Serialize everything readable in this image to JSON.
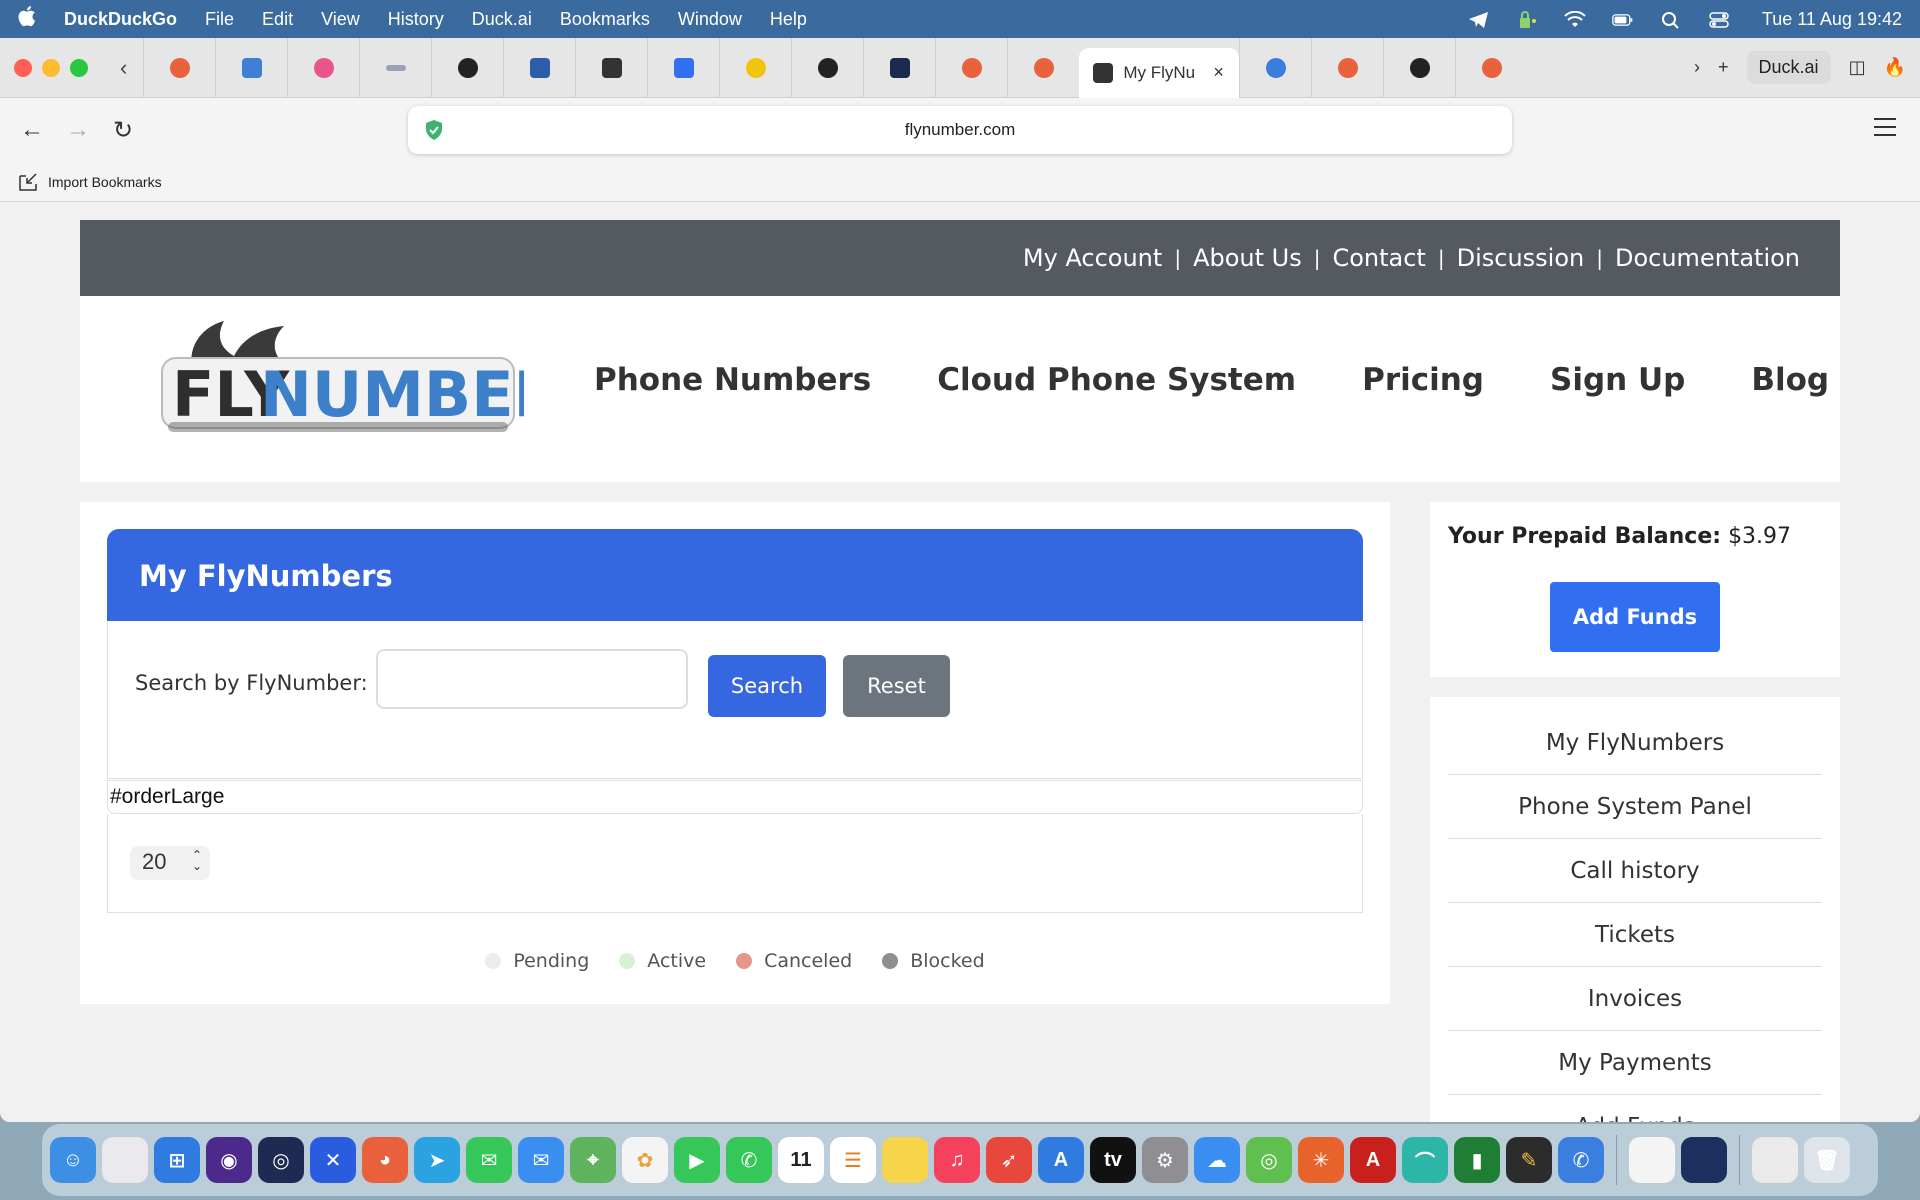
{
  "menubar": {
    "app": "DuckDuckGo",
    "items": [
      "File",
      "Edit",
      "View",
      "History",
      "Duck.ai",
      "Bookmarks",
      "Window",
      "Help"
    ],
    "clock": "Tue 11 Aug  19:42"
  },
  "browser": {
    "active_tab_title": "My FlyNu",
    "duckai_label": "Duck.ai",
    "url": "flynumber.com",
    "bookmarks_import": "Import Bookmarks"
  },
  "site": {
    "top_links": [
      "My Account",
      "About Us",
      "Contact",
      "Discussion",
      "Documentation"
    ],
    "logo_text_dark": "FLY",
    "logo_text_blue": "NUMBER",
    "main_nav": [
      "Phone Numbers",
      "Cloud Phone System",
      "Pricing",
      "Sign Up",
      "Blog"
    ]
  },
  "panel": {
    "title": "My FlyNumbers",
    "search_label": "Search by FlyNumber:",
    "search_value": "",
    "search_button": "Search",
    "reset_button": "Reset",
    "order_label": "#orderLarge",
    "per_page": "20",
    "legend": [
      {
        "label": "Pending",
        "color": "#ececec"
      },
      {
        "label": "Active",
        "color": "#d8f0d4"
      },
      {
        "label": "Canceled",
        "color": "#e8958b"
      },
      {
        "label": "Blocked",
        "color": "#8f8f8f"
      }
    ]
  },
  "sidebar": {
    "balance_label": "Your Prepaid Balance:",
    "balance_value": "$3.97",
    "add_funds": "Add Funds",
    "menu": [
      "My FlyNumbers",
      "Phone System Panel",
      "Call history",
      "Tickets",
      "Invoices",
      "My Payments",
      "Add Funds"
    ]
  },
  "colors": {
    "accent_blue": "#3567e0",
    "top_bar": "#555960",
    "reset_gray": "#6c757d"
  }
}
